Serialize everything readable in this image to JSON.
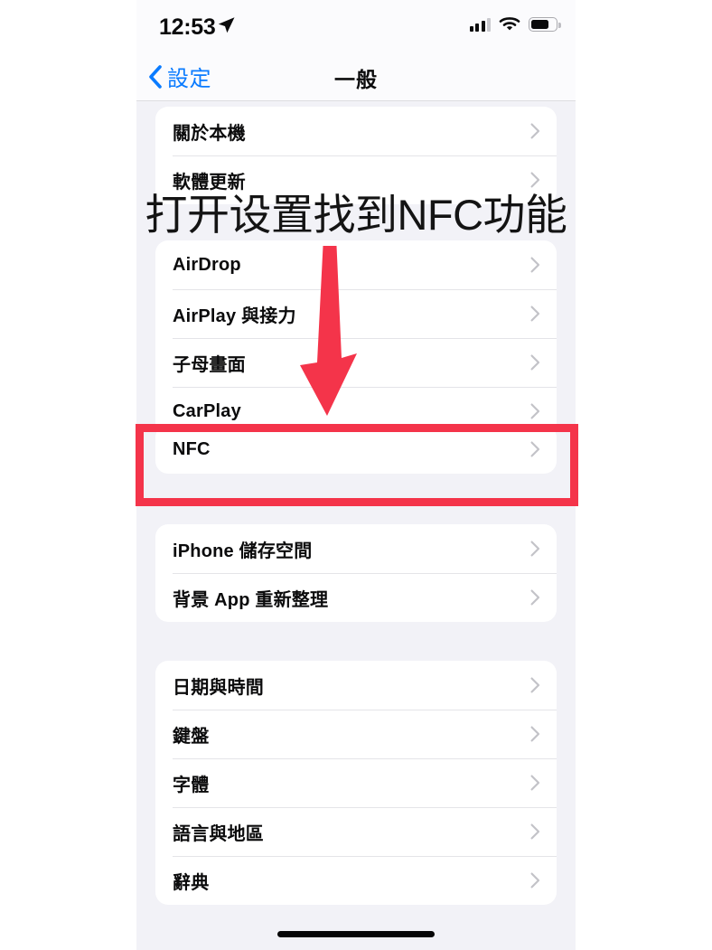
{
  "status_bar": {
    "time": "12:53",
    "location_icon": "location-arrow-icon",
    "cellular_icon": "cellular-signal-icon",
    "wifi_icon": "wifi-icon",
    "battery_icon": "battery-icon",
    "battery_level_percent": 62
  },
  "nav_bar": {
    "back_label": "設定",
    "back_icon": "chevron-left-icon",
    "title": "一般"
  },
  "groups": [
    {
      "id": "group-device",
      "rows": [
        {
          "label": "關於本機",
          "icon": "chevron-right-icon"
        },
        {
          "label": "軟體更新",
          "icon": "chevron-right-icon"
        }
      ]
    },
    {
      "id": "group-sharing",
      "rows": [
        {
          "label": "AirDrop",
          "icon": "chevron-right-icon"
        },
        {
          "label": "AirPlay 與接力",
          "icon": "chevron-right-icon"
        },
        {
          "label": "子母畫面",
          "icon": "chevron-right-icon"
        },
        {
          "label": "CarPlay",
          "icon": "chevron-right-icon"
        }
      ]
    },
    {
      "id": "group-nfc",
      "rows": [
        {
          "label": "NFC",
          "icon": "chevron-right-icon"
        }
      ]
    },
    {
      "id": "group-storage",
      "rows": [
        {
          "label": "iPhone 儲存空間",
          "icon": "chevron-right-icon"
        },
        {
          "label": "背景 App 重新整理",
          "icon": "chevron-right-icon"
        }
      ]
    },
    {
      "id": "group-localization",
      "rows": [
        {
          "label": "日期與時間",
          "icon": "chevron-right-icon"
        },
        {
          "label": "鍵盤",
          "icon": "chevron-right-icon"
        },
        {
          "label": "字體",
          "icon": "chevron-right-icon"
        },
        {
          "label": "語言與地區",
          "icon": "chevron-right-icon"
        },
        {
          "label": "辭典",
          "icon": "chevron-right-icon"
        }
      ]
    }
  ],
  "annotations": {
    "caption": "打开设置找到NFC功能",
    "arrow_icon": "down-arrow-annotation-icon",
    "highlight_target": "NFC",
    "accent_color": "#F4344A",
    "caption_color": "#141414"
  },
  "colors": {
    "tint_blue": "#0A7BFF",
    "screen_background": "#F2F2F7",
    "card_background": "#FFFFFF",
    "chevron_gray": "#C3C3C8",
    "separator": "#E4E4E8"
  },
  "home_indicator": "home-indicator"
}
